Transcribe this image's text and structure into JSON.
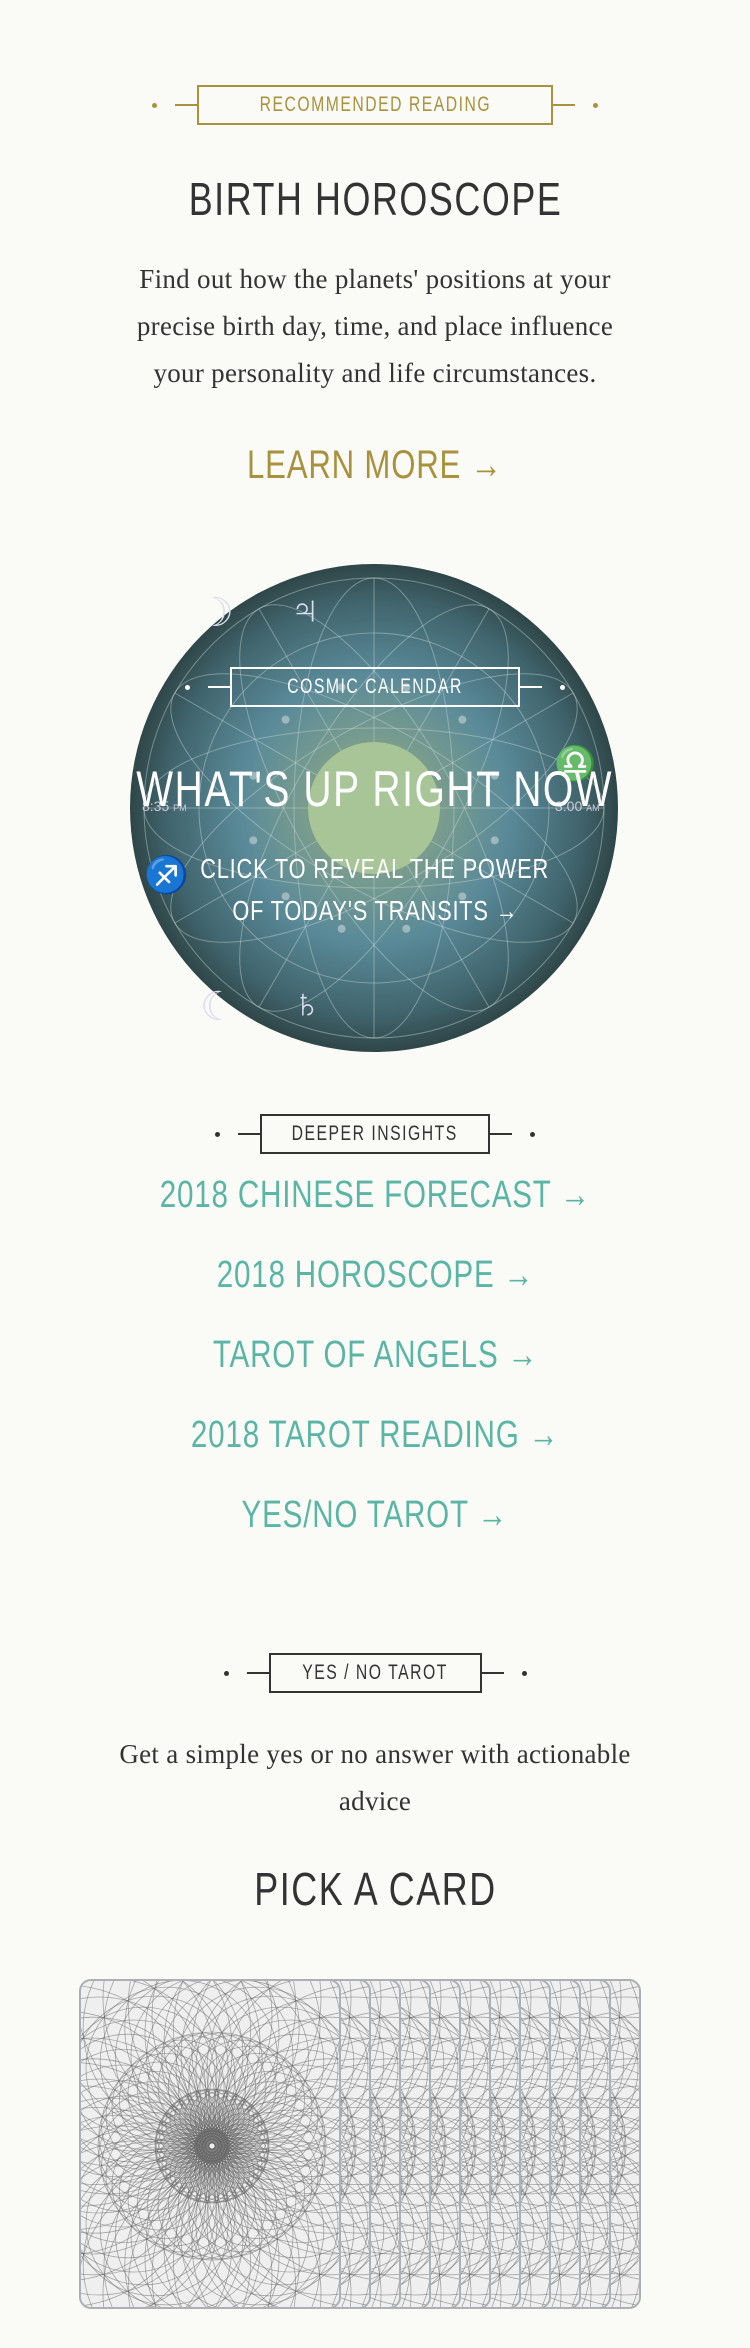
{
  "recommended": {
    "label": "RECOMMENDED READING",
    "title": "BIRTH HOROSCOPE",
    "description_lines": [
      "Find out how the planets' positions at your",
      "precise birth day, time, and place influence",
      "your personality and life circumstances."
    ],
    "cta": "LEARN MORE →",
    "accent": "#a8923e"
  },
  "cosmic": {
    "label": "COSMIC CALENDAR",
    "title": "WHAT'S UP RIGHT NOW",
    "cta_lines": [
      "CLICK TO REVEAL THE POWER",
      "OF TODAY'S TRANSITS →"
    ],
    "time_left": "8:35",
    "time_left_suffix": "PM",
    "time_right": "3:00",
    "time_right_suffix": "AM",
    "glyphs": {
      "moon": "☽",
      "jupiter": "♃",
      "libra": "♎",
      "sagittarius": "♐",
      "saturn": "♄"
    }
  },
  "insights": {
    "label": "DEEPER INSIGHTS",
    "links": [
      "2018 CHINESE FORECAST →",
      "2018 HOROSCOPE →",
      "TAROT OF ANGELS →",
      "2018 TAROT READING →",
      "YES/NO TAROT →"
    ],
    "link_color": "#5bb5a5"
  },
  "yesno": {
    "label": "YES / NO TAROT",
    "description_lines": [
      "Get a simple yes or no answer with actionable",
      "advice"
    ],
    "title": "PICK A CARD",
    "card_count": 11
  }
}
